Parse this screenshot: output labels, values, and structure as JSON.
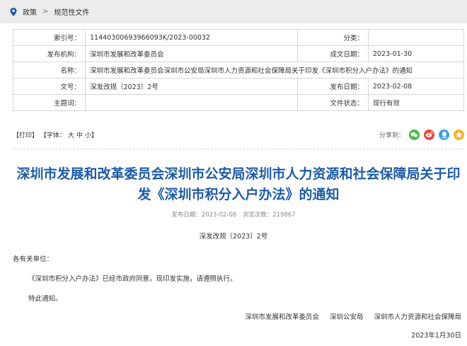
{
  "breadcrumb": {
    "items": [
      "政策",
      "规范性文件"
    ],
    "separator": ">"
  },
  "meta": {
    "index_label": "索引号：",
    "index_value": "11440300693966093K/2023-00032",
    "category_label": "分类：",
    "category_value": "",
    "issuer_label": "发布机构：",
    "issuer_value": "深圳市发展和改革委员会",
    "created_label": "成文日期：",
    "created_value": "2023-01-30",
    "name_label": "名称：",
    "name_value": "深圳市发展和改革委员会深圳市公安局深圳市人力资源和社会保障局关于印发《深圳市积分入户办法》的通知",
    "docno_label": "文号：",
    "docno_value": "深发改规〔2023〕2号",
    "pubdate_label": "发布日期：",
    "pubdate_value": "2023-02-08",
    "subject_label": "主题词：",
    "subject_value": "",
    "status_label": "文件状态：",
    "status_value": "现行有效"
  },
  "tools": {
    "print": "【打印】",
    "font_prefix": "【字体：",
    "font_large": "大",
    "font_medium": "中",
    "font_small": "小",
    "font_suffix": "】",
    "share_label": "分享到："
  },
  "colors": {
    "title": "#1d5ba4",
    "wechat": "#4fb848",
    "weibo": "#e5493b",
    "qq": "#3aa0e8",
    "qzone": "#f4b324"
  },
  "article": {
    "title": "深圳市发展和改革委员会深圳市公安局深圳市人力资源和社会保障局关于印发《深圳市积分入户办法》的通知",
    "pubinfo": "发布日期：2023-02-08　浏览次数：219867",
    "docno": "深发改规〔2023〕2号",
    "p1": "各有关单位：",
    "p2": "《深圳市积分入户办法》已经市政府同意，现印发实施，请遵照执行。",
    "p3": "特此通知。",
    "signers": [
      "深圳市发展和改革委员会",
      "深圳公安局",
      "深圳市人力资源和社会保障局"
    ],
    "date": "2023年1月30日"
  }
}
